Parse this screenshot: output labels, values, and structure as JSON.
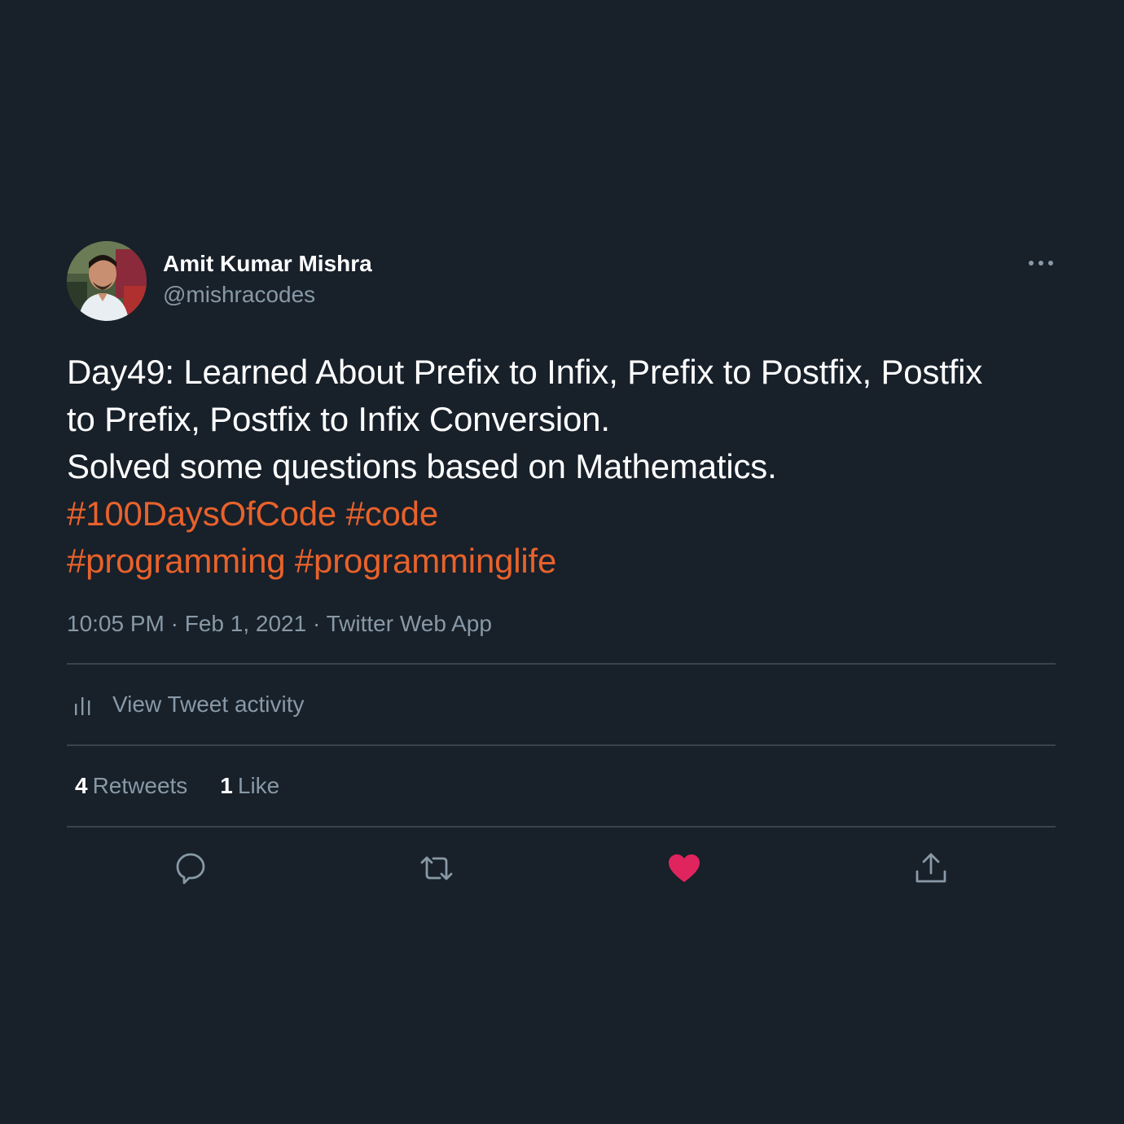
{
  "author": {
    "display_name": "Amit Kumar Mishra",
    "handle": "@mishracodes"
  },
  "tweet": {
    "line1": "Day49: Learned About Prefix to Infix, Prefix to Postfix, Postfix",
    "line2": "to Prefix, Postfix to Infix Conversion.",
    "line3": "Solved some questions based on Mathematics.",
    "hashtags": [
      "#100DaysOfCode",
      "#code",
      "#programming",
      "#programminglife"
    ]
  },
  "meta": {
    "time": "10:05 PM",
    "date": "Feb 1, 2021",
    "source": "Twitter Web App",
    "separator": "·"
  },
  "activity": {
    "label": "View Tweet activity"
  },
  "stats": {
    "retweets_count": "4",
    "retweets_label": "Retweets",
    "likes_count": "1",
    "likes_label": "Like"
  },
  "icons": {
    "more": "more-icon",
    "activity": "analytics-icon",
    "reply": "reply-icon",
    "retweet": "retweet-icon",
    "like": "heart-icon",
    "share": "share-icon"
  },
  "colors": {
    "background": "#18202a",
    "hashtag": "#e8622b",
    "secondary_text": "#8899a6",
    "like_active": "#e0245e",
    "divider": "#38444d"
  }
}
